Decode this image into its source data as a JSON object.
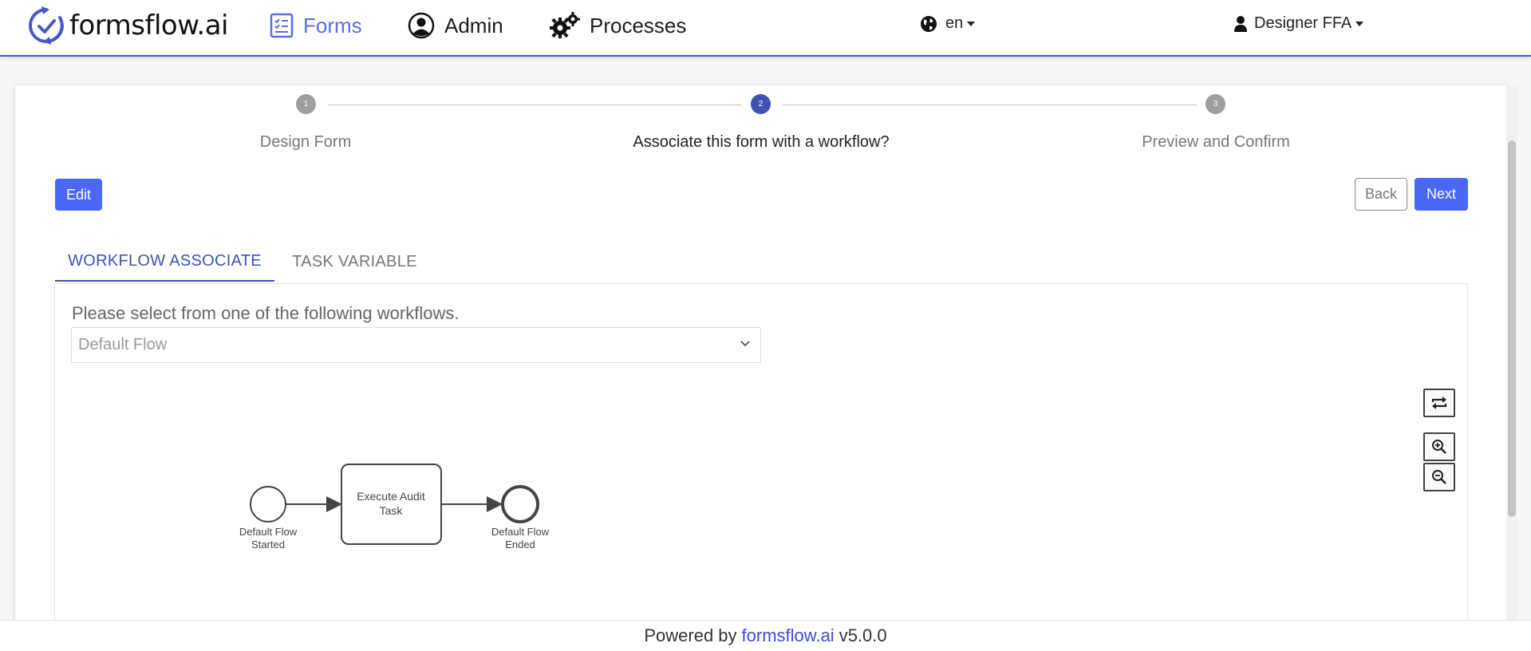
{
  "header": {
    "brand": "formsflow.ai",
    "nav": [
      {
        "label": "Forms",
        "icon": "forms-icon"
      },
      {
        "label": "Admin",
        "icon": "user-circle-icon"
      },
      {
        "label": "Processes",
        "icon": "gears-icon"
      }
    ],
    "language": "en",
    "user": "Designer FFA"
  },
  "stepper": {
    "steps": [
      {
        "number": "1",
        "label": "Design Form"
      },
      {
        "number": "2",
        "label": "Associate this form with a workflow?"
      },
      {
        "number": "3",
        "label": "Preview and Confirm"
      }
    ],
    "active_step": 2
  },
  "actions": {
    "edit": "Edit",
    "back": "Back",
    "next": "Next"
  },
  "tabs": [
    {
      "label": "WORKFLOW ASSOCIATE"
    },
    {
      "label": "TASK VARIABLE"
    }
  ],
  "workflow": {
    "prompt": "Please select from one of the following workflows.",
    "selected": "Default Flow"
  },
  "diagram": {
    "start_label_1": "Default Flow",
    "start_label_2": "Started",
    "task_label_1": "Execute Audit",
    "task_label_2": "Task",
    "end_label_1": "Default Flow",
    "end_label_2": "Ended"
  },
  "footer": {
    "prefix": "Powered by",
    "brand": "formsflow.ai",
    "version": "v5.0.0"
  },
  "colors": {
    "accent": "#4a67f5",
    "tab_active": "#3f51b5",
    "step_active": "#3f51b5",
    "step_inactive": "#9e9e9e"
  }
}
